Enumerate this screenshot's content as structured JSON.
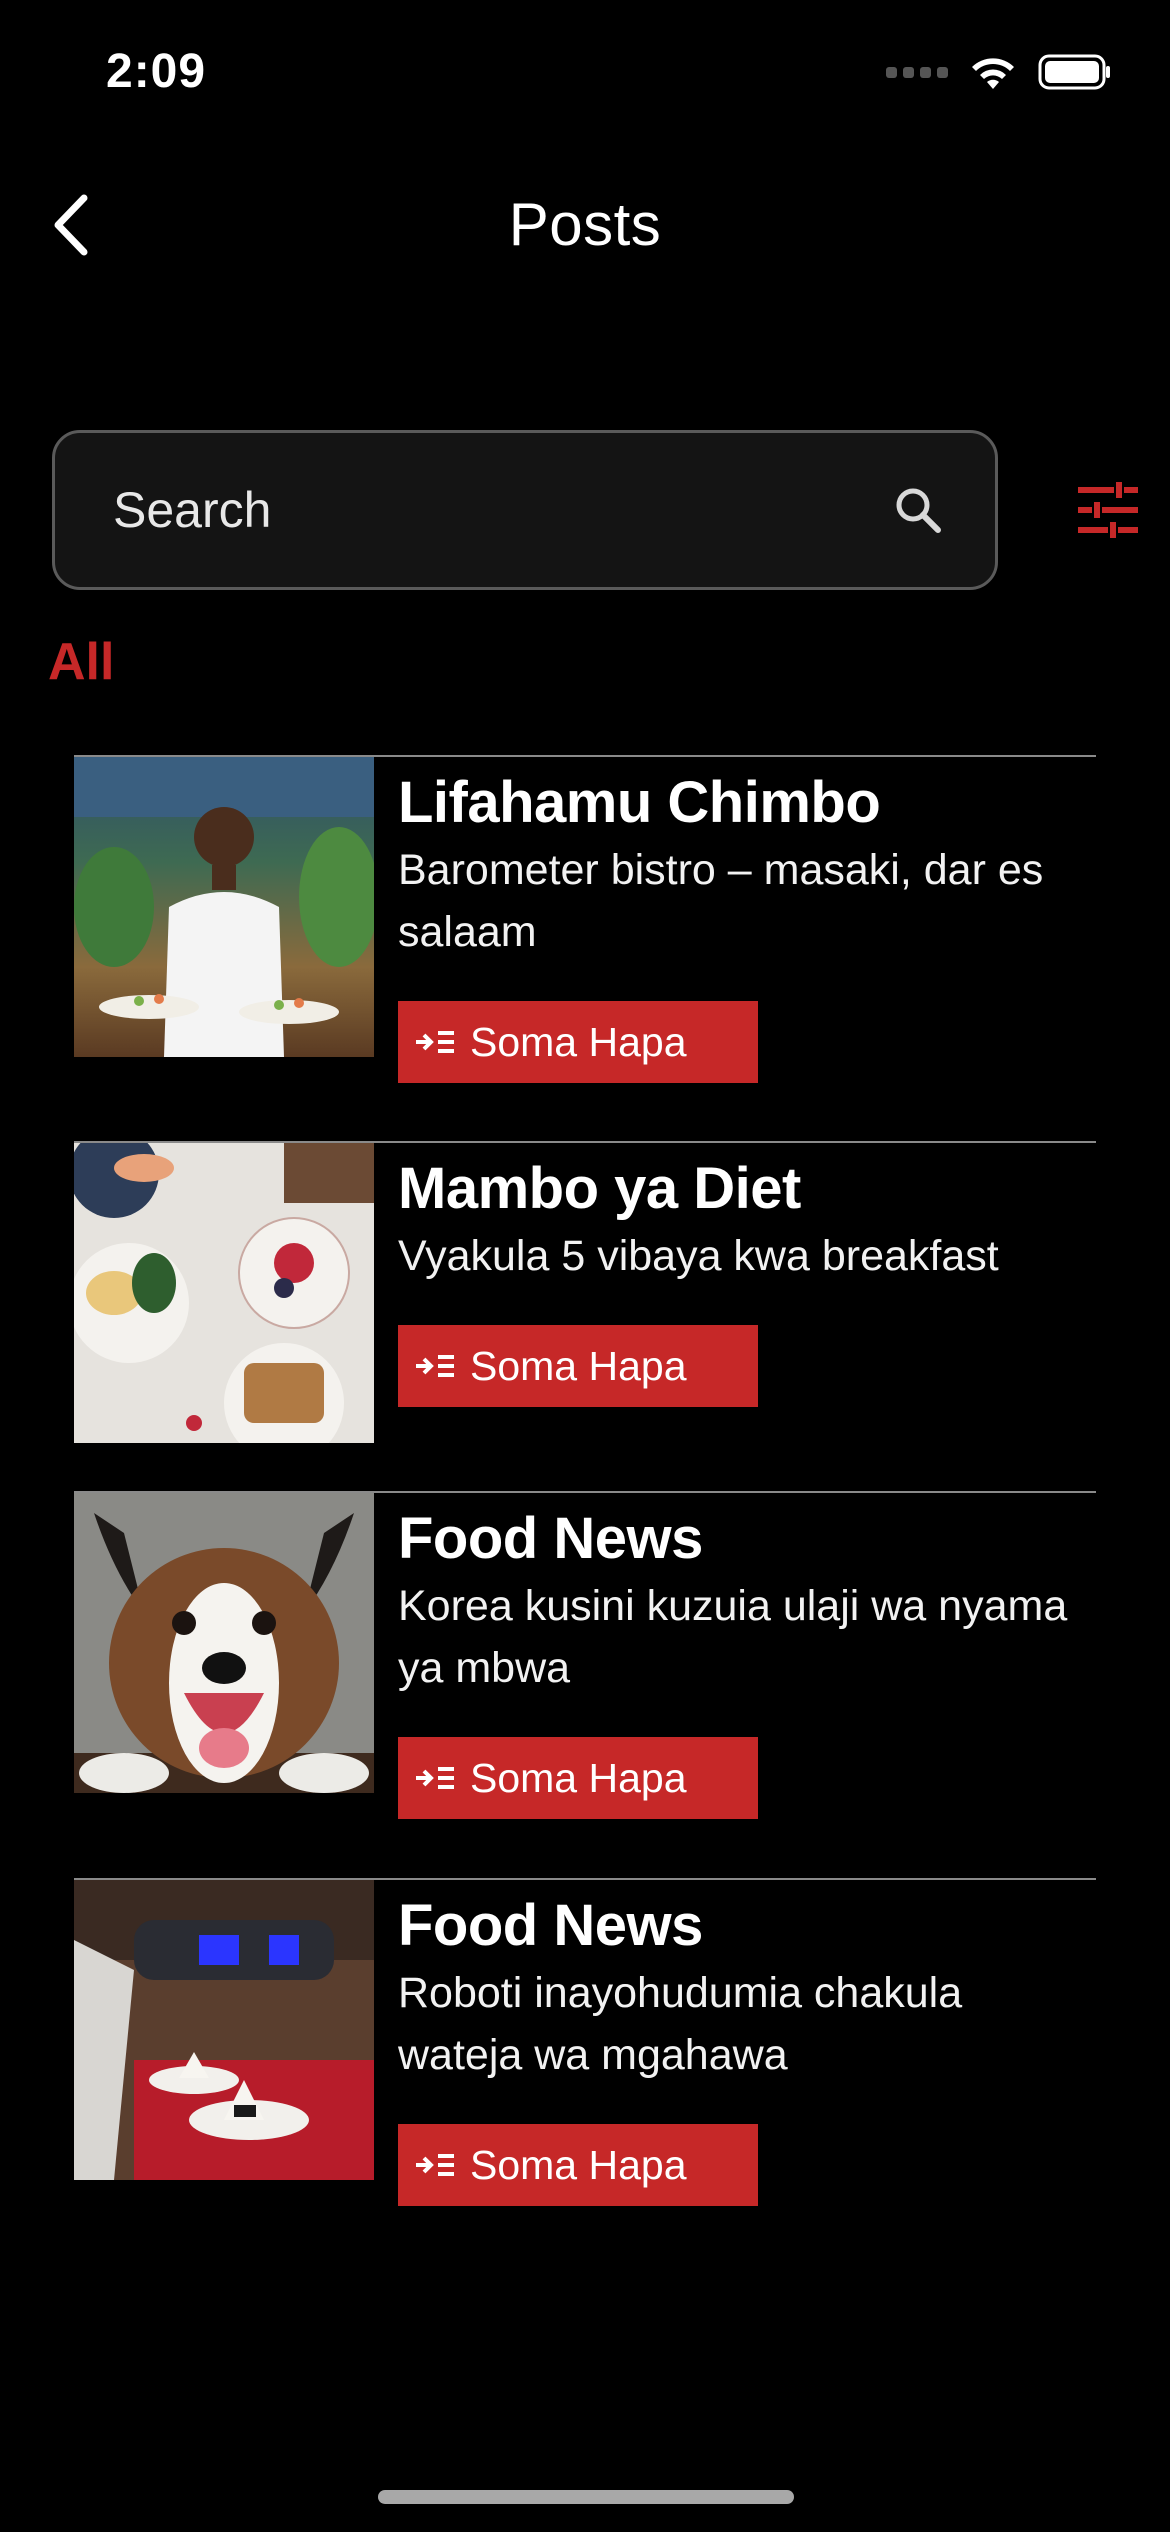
{
  "status_bar": {
    "time": "2:09"
  },
  "header": {
    "title": "Posts"
  },
  "search": {
    "placeholder": "Search"
  },
  "filter_tab": {
    "label": "All"
  },
  "accent_color": "#c62828",
  "posts": [
    {
      "category": "Lifahamu Chimbo",
      "title": "Barometer bistro – masaki, dar es salaam",
      "button": "Soma Hapa",
      "image": "chef-holding-plates-photo"
    },
    {
      "category": "Mambo ya Diet",
      "title": "Vyakula 5 vibaya kwa breakfast",
      "button": "Soma Hapa",
      "image": "breakfast-plates-photo"
    },
    {
      "category": "Food News",
      "title": "Korea kusini kuzuia ulaji wa nyama ya mbwa",
      "button": "Soma Hapa",
      "image": "dog-photo"
    },
    {
      "category": "Food News",
      "title": "Roboti inayohudumia chakula wateja wa mgahawa",
      "button": "Soma Hapa",
      "image": "serving-robot-photo"
    }
  ]
}
